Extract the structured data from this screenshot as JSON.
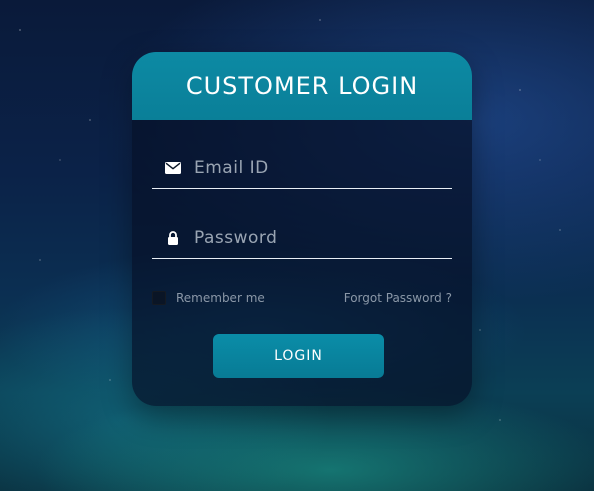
{
  "login_card": {
    "title": "CUSTOMER LOGIN",
    "email_placeholder": "Email ID",
    "password_placeholder": "Password",
    "remember_me_label": "Remember me",
    "forgot_password_label": "Forgot Password ?",
    "login_button_label": "LOGIN",
    "icons": {
      "email": "envelope-icon",
      "password": "lock-icon"
    },
    "colors": {
      "accent": "#0a8aa4",
      "card_background": "#06101f"
    }
  }
}
